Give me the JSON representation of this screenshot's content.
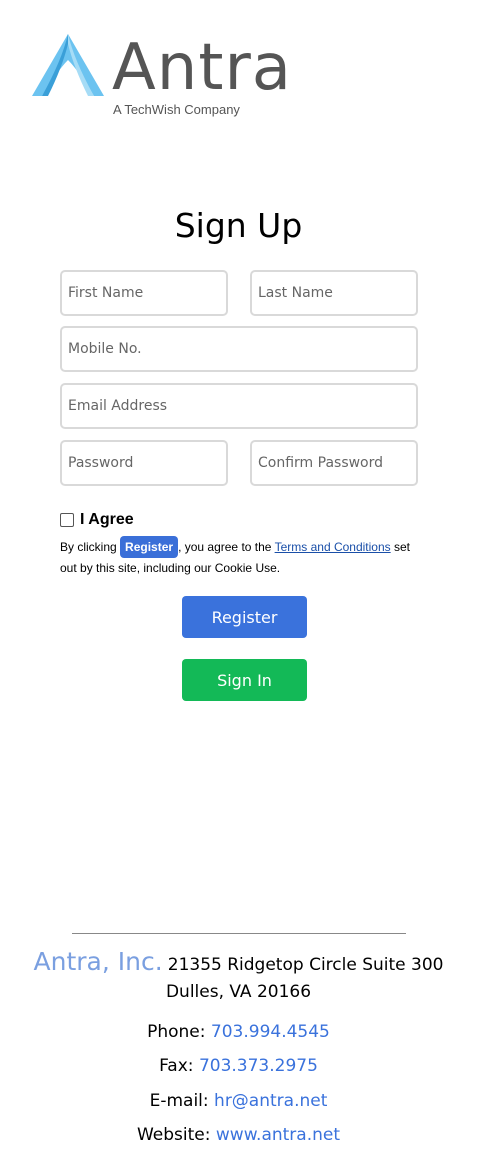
{
  "brand": {
    "name": "Antra",
    "tagline": "A TechWish Company"
  },
  "form": {
    "title": "Sign Up",
    "first_name_placeholder": "First Name",
    "last_name_placeholder": "Last Name",
    "mobile_placeholder": "Mobile No.",
    "email_placeholder": "Email Address",
    "password_placeholder": "Password",
    "confirm_password_placeholder": "Confirm Password",
    "agree_label": "I Agree",
    "terms_prefix": "By clicking",
    "terms_button": "Register",
    "terms_middle": ", you agree to the",
    "terms_link": "Terms and Conditions",
    "terms_suffix": "set out by this site, including our Cookie Use.",
    "register_label": "Register",
    "signin_label": "Sign In"
  },
  "footer": {
    "company": "Antra, Inc.",
    "address_line1": "21355 Ridgetop Circle Suite 300",
    "address_line2": "Dulles, VA 20166",
    "phone_label": "Phone:",
    "phone": "703.994.4545",
    "fax_label": "Fax:",
    "fax": "703.373.2975",
    "email_label": "E-mail:",
    "email": "hr@antra.net",
    "website_label": "Website:",
    "website": "www.antra.net"
  },
  "colors": {
    "register": "#3a72dc",
    "signin": "#13b957",
    "company": "#7a9fe0",
    "link": "#3a72dc",
    "logo_blue": "#5ab4e8"
  }
}
